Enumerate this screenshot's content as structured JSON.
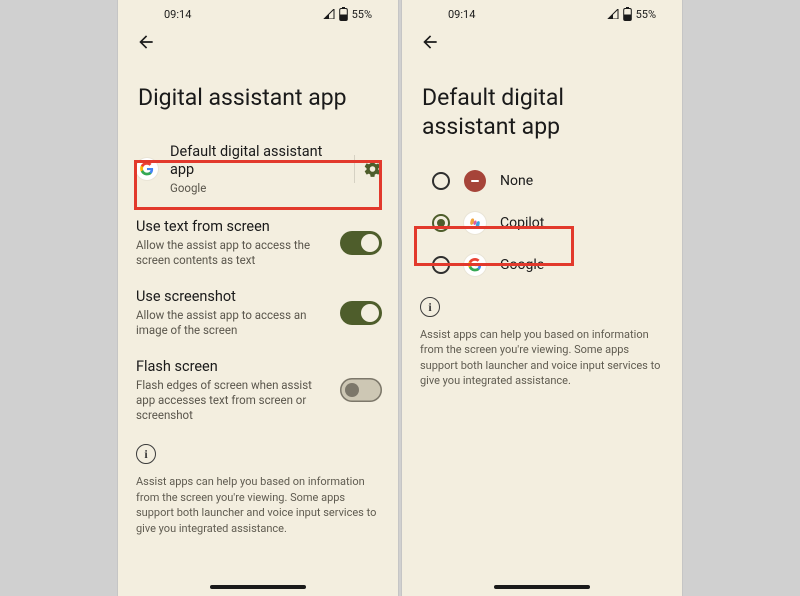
{
  "status": {
    "time": "09:14",
    "battery": "55%"
  },
  "screen1": {
    "title": "Digital assistant app",
    "default_item": {
      "title": "Default digital assistant app",
      "value": "Google"
    },
    "options": [
      {
        "title": "Use text from screen",
        "sub": "Allow the assist app to access the screen contents as text",
        "on": true
      },
      {
        "title": "Use screenshot",
        "sub": "Allow the assist app to access an image of the screen",
        "on": true
      },
      {
        "title": "Flash screen",
        "sub": "Flash edges of screen when assist app accesses text from screen or screenshot",
        "on": false
      }
    ],
    "info": "Assist apps can help you based on information from the screen you're viewing. Some apps support both launcher and voice input services to give you integrated assistance."
  },
  "screen2": {
    "title": "Default digital assistant app",
    "choices": [
      {
        "label": "None",
        "selected": false,
        "icon": "none"
      },
      {
        "label": "Copilot",
        "selected": true,
        "icon": "copilot"
      },
      {
        "label": "Google",
        "selected": false,
        "icon": "google"
      }
    ],
    "info": "Assist apps can help you based on information from the screen you're viewing. Some apps support both launcher and voice input services to give you integrated assistance."
  }
}
